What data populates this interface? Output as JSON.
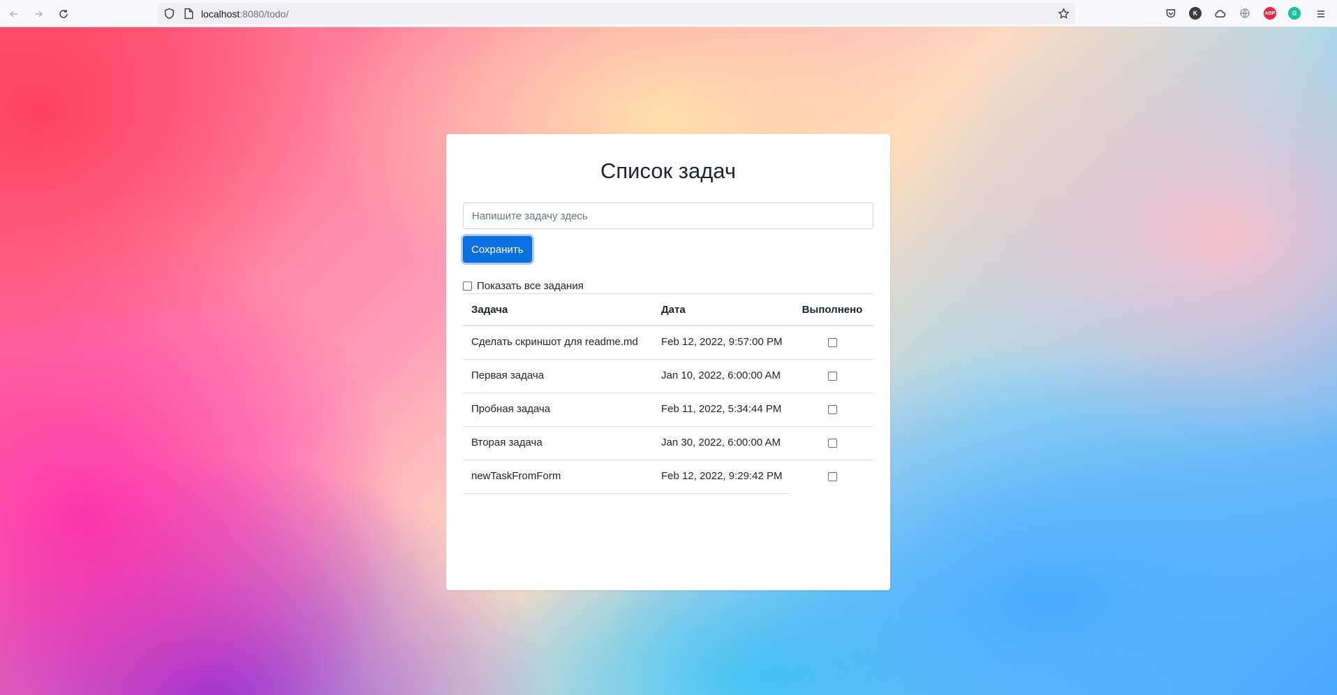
{
  "browser": {
    "url_host": "localhost",
    "url_rest": ":8080/todo/",
    "extensions": [
      {
        "name": "pocket-icon"
      },
      {
        "name": "k-extension-icon",
        "label": "K",
        "color": "#3d3d3d"
      },
      {
        "name": "cloud-icon"
      },
      {
        "name": "globe-icon"
      },
      {
        "name": "adblock-icon",
        "label": "ABP",
        "color": "#e8264a"
      },
      {
        "name": "grammarly-icon",
        "label": "G",
        "color": "#15c39a"
      }
    ]
  },
  "todo": {
    "title": "Список задач",
    "input_placeholder": "Напишите задачу здесь",
    "save_label": "Сохранить",
    "show_all_label": "Показать все задания",
    "columns": {
      "task": "Задача",
      "date": "Дата",
      "done": "Выполнено"
    },
    "rows": [
      {
        "task": "Сделать скриншот для readme.md",
        "date": "Feb 12, 2022, 9:57:00 PM",
        "done": false
      },
      {
        "task": "Первая задача",
        "date": "Jan 10, 2022, 6:00:00 AM",
        "done": false
      },
      {
        "task": "Пробная задача",
        "date": "Feb 11, 2022, 5:34:44 PM",
        "done": false
      },
      {
        "task": "Вторая задача",
        "date": "Jan 30, 2022, 6:00:00 AM",
        "done": false
      },
      {
        "task": "newTaskFromForm",
        "date": "Feb 12, 2022, 9:29:42 PM",
        "done": false
      }
    ]
  },
  "colors": {
    "primary_button": "#0b6fe0"
  }
}
